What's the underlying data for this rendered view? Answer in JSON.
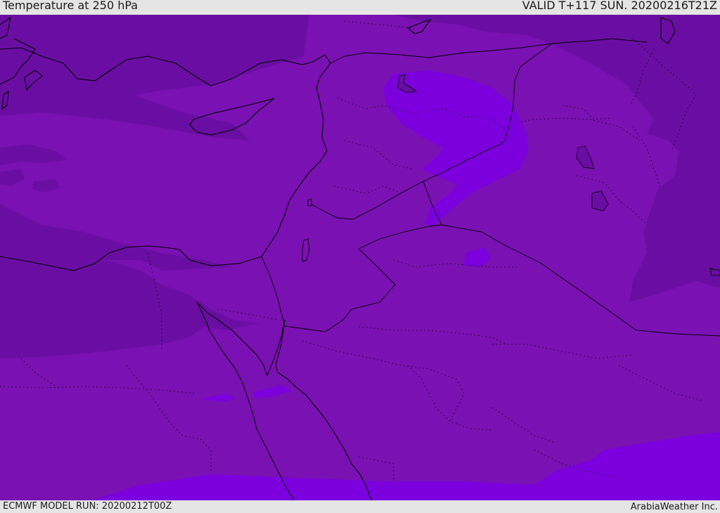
{
  "header": {
    "title": "Temperature at 250 hPa",
    "valid": "VALID T+117 SUN. 20200216T21Z"
  },
  "footer": {
    "model_run": "ECMWF MODEL RUN: 20200212T00Z",
    "credit": "ArabiaWeather Inc."
  },
  "map": {
    "colors": {
      "base": "#7a11b3",
      "dark": "#6a0ea3",
      "bright": "#7c00de",
      "border": "#000000"
    }
  }
}
